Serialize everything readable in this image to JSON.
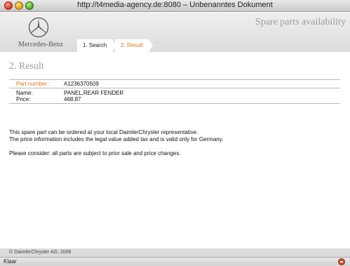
{
  "window": {
    "title": "http://t4media-agency.de:8080 – Unbenanntes Dokument"
  },
  "header": {
    "logo_text": "Mercedes-Benz",
    "app_title": "Spare parts availability",
    "tabs": [
      {
        "label": "1. Search",
        "active": false
      },
      {
        "label": "2. Result",
        "active": true
      }
    ]
  },
  "result": {
    "title": "2. Result",
    "part_number_label": "Part number :",
    "part_number_value": "A1236370509",
    "name_label": "Name:",
    "name_value": "PANEL,REAR FENDER",
    "price_label": "Price:",
    "price_value": "468,87"
  },
  "notes": {
    "line1": "This spare part can be ordered at your local DaimlerChrysler representative.",
    "line2": "The price information includes the legal value added tax and is valid only for Germany.",
    "line3": "Please consider: all parts are subject to prior sale and price changes."
  },
  "footer": {
    "copyright": "© DaimlerChrysler AG, 2006"
  },
  "statusbar": {
    "text": "Klaar"
  },
  "colors": {
    "accent": "#e07a1c",
    "header_bg": "#dcdcdc",
    "title_grey": "#9a9a9a"
  }
}
